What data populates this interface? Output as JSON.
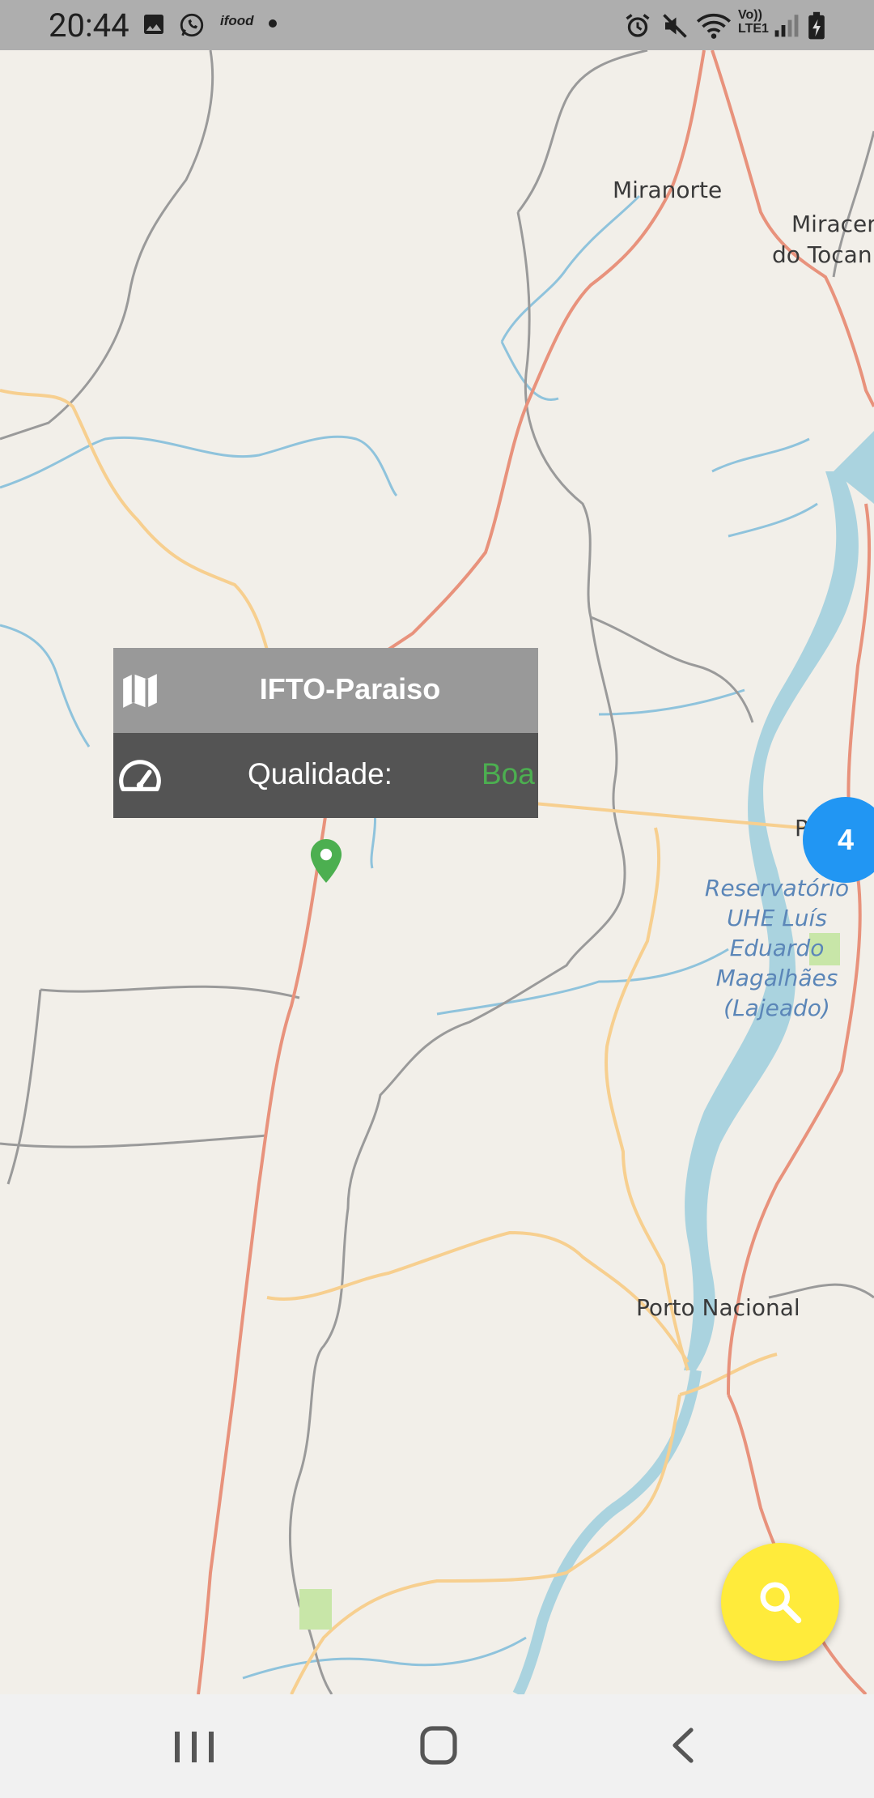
{
  "status_bar": {
    "time": "20:44",
    "icons_left": [
      "image-icon",
      "whatsapp-icon",
      "ifood-icon",
      "dot-icon"
    ],
    "icons_right": [
      "alarm-icon",
      "mute-icon",
      "wifi-icon",
      "volte-icon",
      "signal-icon",
      "battery-charging-icon"
    ],
    "ifood_text": "ifood",
    "volte_text": "Vo))",
    "lte_text": "LTE1"
  },
  "map": {
    "place_labels": {
      "miranorte": "Miranorte",
      "miracema_line1": "Miracer",
      "miracema_line2": "do Tocan",
      "porto_nacional": "Porto Nacional",
      "cut_label": "P"
    },
    "water_label": [
      "Reservatório",
      "UHE Luís",
      "Eduardo",
      "Magalhães",
      "(Lajeado)"
    ],
    "colors": {
      "land": "#f2efe9",
      "water": "#aad3df",
      "primary_road": "#e8927c",
      "secondary_road": "#f7cf8f",
      "border": "#9a9a9a",
      "river": "#8fc3dc"
    }
  },
  "popup": {
    "title": "IFTO-Paraiso",
    "title_icon": "map-icon",
    "quality_icon": "speedometer-icon",
    "quality_label": "Qualidade:",
    "quality_value": "Boa",
    "quality_color": "#4caf50"
  },
  "marker": {
    "icon": "map-pin-icon",
    "color": "#4caf50"
  },
  "cluster": {
    "count": "4",
    "color": "#2196f3"
  },
  "fab": {
    "icon": "search-icon",
    "color": "#ffeb3b"
  },
  "nav_bar": {
    "recents": "recents-icon",
    "home": "home-icon",
    "back": "back-icon"
  }
}
